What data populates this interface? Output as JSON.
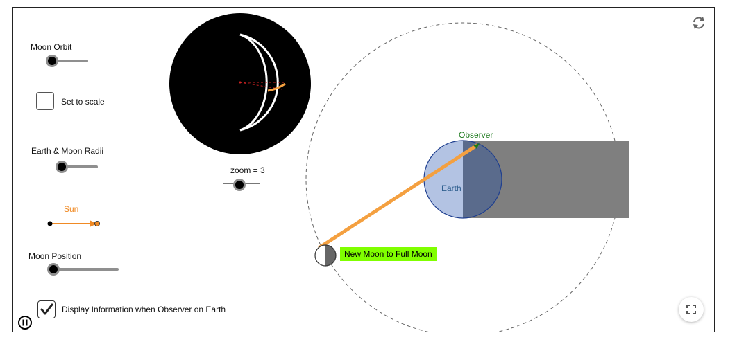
{
  "controls": {
    "moon_orbit_label": "Moon Orbit",
    "moon_orbit_value": 0,
    "set_to_scale_label": "Set to scale",
    "set_to_scale_checked": false,
    "radii_label": "Earth & Moon Radii",
    "radii_value": 0,
    "sun_label": "Sun",
    "moon_position_label": "Moon Position",
    "moon_position_value": 0,
    "display_info_label": "Display Information when Observer on Earth",
    "display_info_checked": true
  },
  "view": {
    "zoom_label": "zoom = 3",
    "zoom_value": 0.5
  },
  "scene": {
    "observer_label": "Observer",
    "earth_label": "Earth",
    "phase_badge": "New Moon to Full Moon"
  },
  "colors": {
    "sun_orange": "#f08a24",
    "ray_orange": "#f4a040",
    "observer_green": "#1e7a1e",
    "earth_light": "#b3c3e3",
    "earth_dark": "#5a6b8c",
    "earth_outline": "#1f3f8f",
    "shadow_gray": "#7f7f7f",
    "badge_green": "#80ff00"
  },
  "icons": {
    "reset": "refresh-icon",
    "fullscreen": "fullscreen-icon",
    "pause": "pause-icon"
  }
}
